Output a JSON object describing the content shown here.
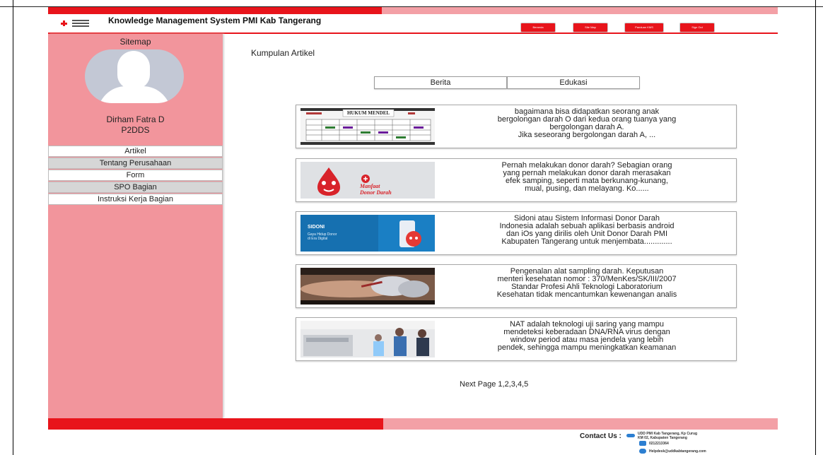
{
  "header": {
    "app_title": "Knowledge Management System PMI Kab Tangerang",
    "nav": [
      "Beranda",
      "Site Map",
      "Panduan KMS",
      "Sign Out"
    ]
  },
  "sidebar": {
    "title": "Sitemap",
    "user_name": "Dirham Fatra D",
    "user_role": "P2DDS",
    "items": [
      {
        "label": "Artikel"
      },
      {
        "label": "Tentang Perusahaan"
      },
      {
        "label": "Form"
      },
      {
        "label": "SPO Bagian"
      },
      {
        "label": "Instruksi Kerja Bagian"
      }
    ]
  },
  "main": {
    "section_title": "Kumpulan Artikel",
    "tabs": [
      "Berita",
      "Edukasi"
    ],
    "articles": [
      {
        "thumb_title": "HUKUM MENDEL",
        "excerpt": "bagaimana bisa didapatkan seorang anak\nbergolongan darah O dari kedua orang tuanya yang\nbergolongan darah A.\nJika seseorang bergolongan darah A, ..."
      },
      {
        "thumb_title": "Manfaat\nDonor Darah",
        "excerpt": "Pernah melakukan donor darah? Sebagian orang\nyang pernah melakukan donor darah merasakan\nefek samping, seperti mata berkunang-kunang,\nmual, pusing, dan melayang. Ko......"
      },
      {
        "thumb_title": "SIDONI",
        "thumb_subtitle": "Gaya Hidup Donor\ndi Era Digital",
        "excerpt": "Sidoni atau Sistem Informasi Donor Darah\nIndonesia adalah sebuah aplikasi berbasis android\ndan iOs yang dirilis oleh Unit Donor Darah PMI\nKabupaten Tangerang untuk menjembata............."
      },
      {
        "excerpt": "Pengenalan alat sampling darah. Keputusan\nmenteri kesehatan nomor : 370/MenKes/SK/III/2007\nStandar Profesi Ahli Teknologi Laboratorium\nKesehatan tidak mencantumkan kewenangan analis"
      },
      {
        "excerpt": "NAT adalah teknologi uji saring yang mampu\nmendeteksi keberadaan DNA/RNA virus dengan\nwindow period atau masa jendela yang lebih\npendek, sehingga mampu meningkatkan keamanan"
      }
    ],
    "pager": "Next Page 1,2,3,4,5"
  },
  "footer": {
    "contact_label": "Contact Us :",
    "address": "UDD PMI Kab Tangerang, Kp Curug\nKM 02, Kabupaten Tangerang",
    "phone": "0212213364",
    "email": "Helpdesk@uddkabtangerang.com"
  }
}
